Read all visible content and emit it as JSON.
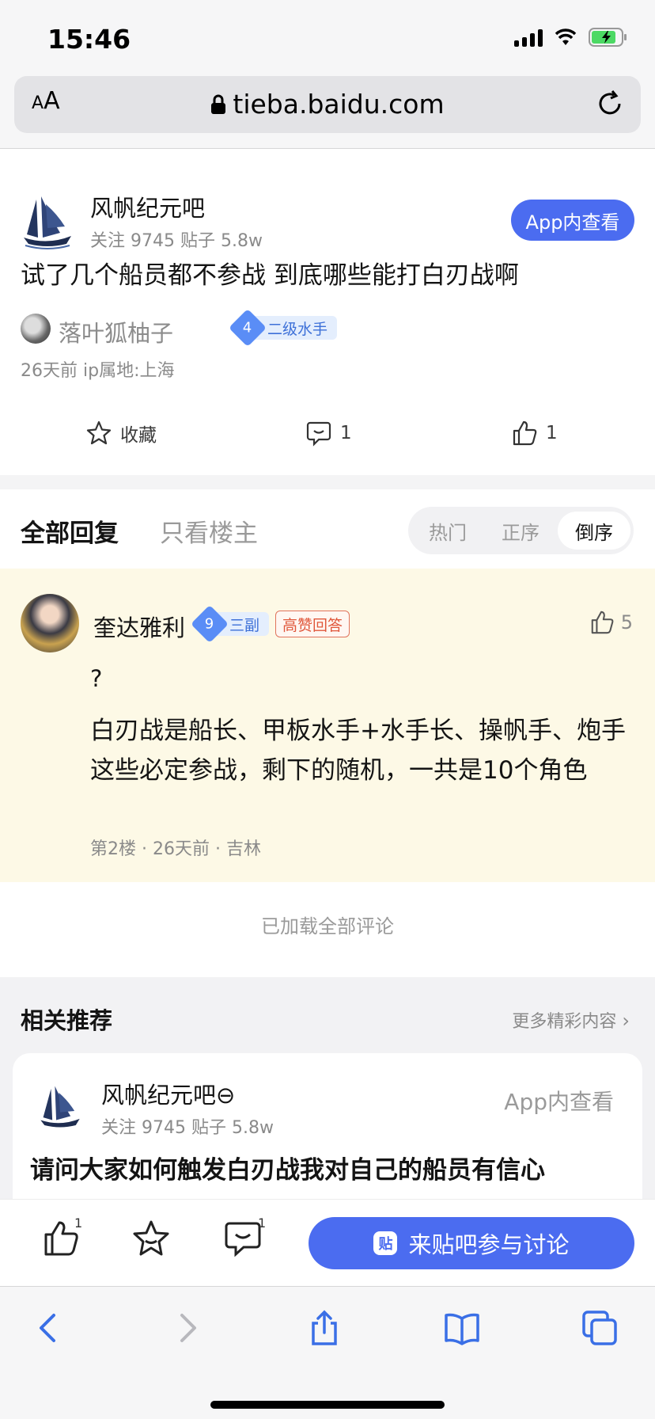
{
  "status_bar": {
    "time": "15:46"
  },
  "browser": {
    "aa_label_small": "A",
    "aa_label_large": "A",
    "url": "tieba.baidu.com"
  },
  "forum": {
    "name": "风帆纪元吧",
    "stats": "关注 9745   贴子 5.8w",
    "app_button": "App内查看"
  },
  "post": {
    "title": "试了几个船员都不参战 到底哪些能打白刃战啊",
    "author": "落叶狐柚子",
    "level_number": "4",
    "level_title": "二级水手",
    "meta": "26天前  ip属地:上海",
    "actions": {
      "favorite_label": "收藏",
      "comment_count": "1",
      "like_count": "1"
    }
  },
  "tabs": {
    "all": "全部回复",
    "owner_only": "只看楼主",
    "sort": [
      "热门",
      "正序",
      "倒序"
    ],
    "sort_active": "倒序"
  },
  "reply": {
    "name": "奎达雅利",
    "level_number": "9",
    "level_title": "三副",
    "badge": "高赞回答",
    "like_count": "5",
    "text_q": "?",
    "text": "白刃战是船长、甲板水手+水手长、操帆手、炮手这些必定参战，剩下的随机，一共是10个角色",
    "meta": "第2楼 · 26天前 · 吉林"
  },
  "loaded_all": "已加载全部评论",
  "related": {
    "title": "相关推荐",
    "more": "更多精彩内容",
    "card": {
      "forum_name": "风帆纪元吧⊖",
      "stats": "关注 9745  贴子 5.8w",
      "app_label": "App内查看",
      "post_title": "请问大家如何触发白刃战我对自己的船员有信心"
    }
  },
  "bottom_bar": {
    "like_count": "1",
    "comment_count": "1",
    "tie_icon": "贴",
    "discuss_label": "来贴吧参与讨论"
  },
  "colors": {
    "accent": "#4b6cf0",
    "reply_bg": "#fdf9e6",
    "level_badge": "#5a8df6",
    "hot_badge": "#e0573b"
  }
}
